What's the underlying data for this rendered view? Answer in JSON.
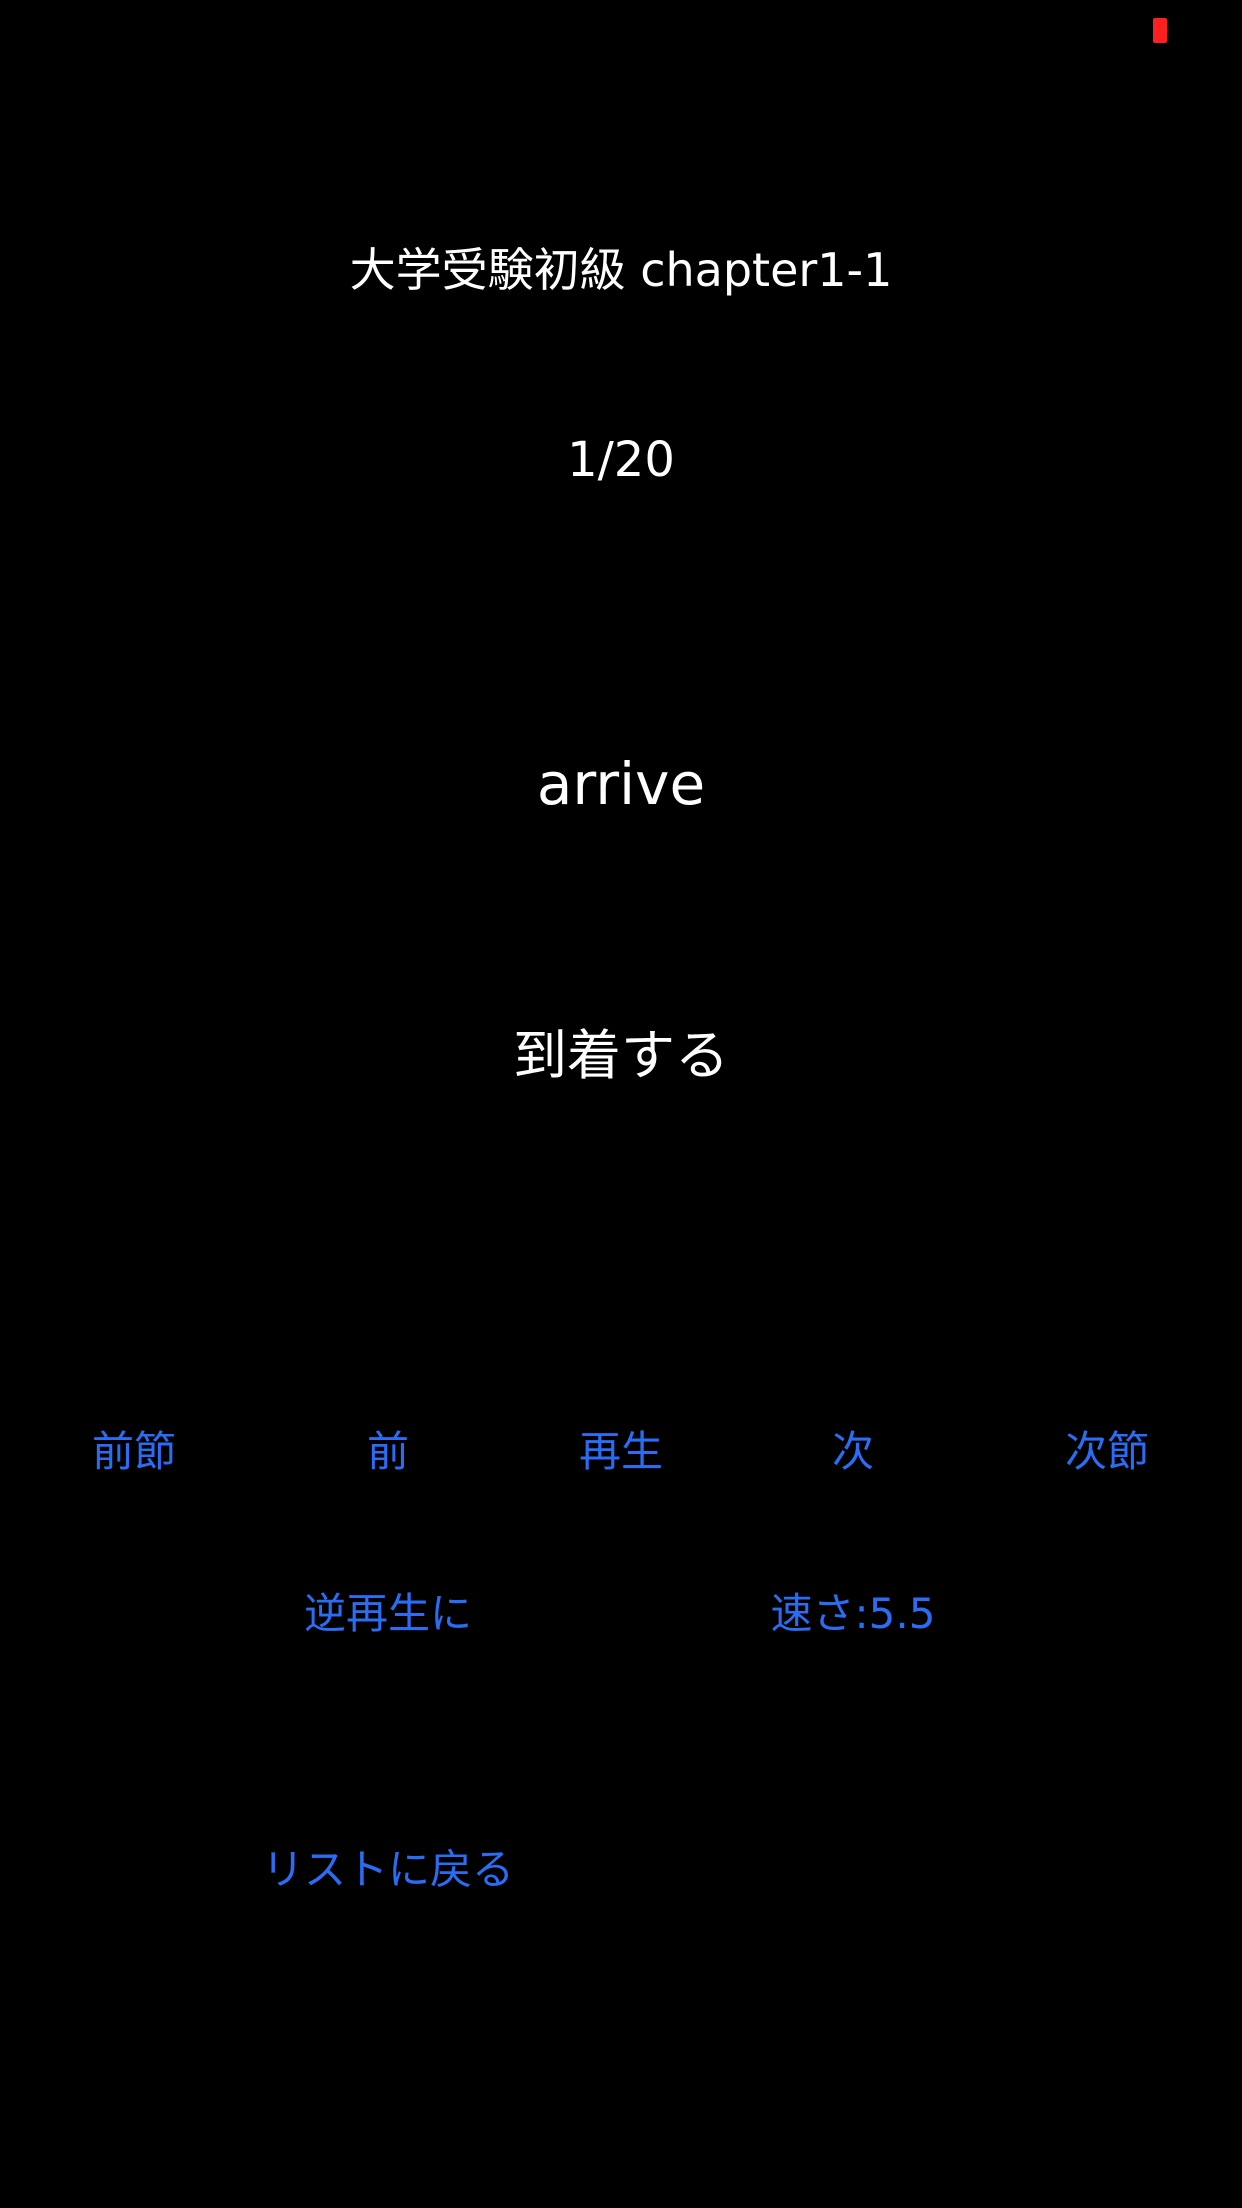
{
  "status_bar": {
    "battery_color": "#ff1f1f"
  },
  "header": {
    "title": "大学受験初級 chapter1-1"
  },
  "progress": {
    "counter": "1/20"
  },
  "card": {
    "word": "arrive",
    "meaning": "到着する"
  },
  "controls": {
    "prev_section": "前節",
    "prev": "前",
    "play": "再生",
    "next": "次",
    "next_section": "次節",
    "reverse_play": "逆再生に",
    "speed": "速さ:5.5",
    "back_to_list": "リストに戻る"
  },
  "colors": {
    "background": "#000000",
    "text": "#ffffff",
    "accent": "#2a6df4"
  }
}
